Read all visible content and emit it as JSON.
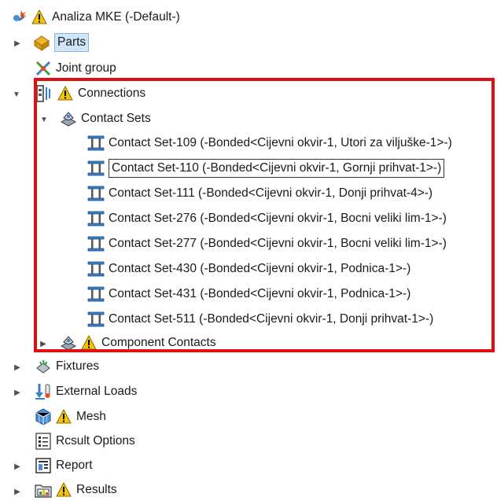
{
  "tree": {
    "root": {
      "label": "Analiza MKE (-Default-)",
      "icon": "study-icon"
    },
    "parts": {
      "label": "Parts",
      "icon": "parts-icon"
    },
    "joint_group": {
      "label": "Joint group",
      "icon": "joint-group-icon"
    },
    "connections": {
      "label": "Connections",
      "icon": "connections-icon"
    },
    "contact_sets": {
      "label": "Contact Sets",
      "icon": "contact-sets-icon"
    },
    "contact_set_items": [
      {
        "label": "Contact Set-109 (-Bonded<Cijevni okvir-1, Utori za viljuške-1>-)"
      },
      {
        "label": "Contact Set-110 (-Bonded<Cijevni okvir-1, Gornji prihvat-1>-)"
      },
      {
        "label": "Contact Set-111 (-Bonded<Cijevni okvir-1, Donji prihvat-4>-)"
      },
      {
        "label": "Contact Set-276 (-Bonded<Cijevni okvir-1, Bocni veliki lim-1>-)"
      },
      {
        "label": "Contact Set-277 (-Bonded<Cijevni okvir-1, Bocni veliki lim-1>-)"
      },
      {
        "label": "Contact Set-430 (-Bonded<Cijevni okvir-1, Podnica-1>-)"
      },
      {
        "label": "Contact Set-431 (-Bonded<Cijevni okvir-1, Podnica-1>-)"
      },
      {
        "label": "Contact Set-511 (-Bonded<Cijevni okvir-1, Donji prihvat-1>-)"
      }
    ],
    "component_contacts": {
      "label": "Component Contacts",
      "icon": "component-contacts-icon"
    },
    "fixtures": {
      "label": "Fixtures",
      "icon": "fixtures-icon"
    },
    "external_loads": {
      "label": "External Loads",
      "icon": "external-loads-icon"
    },
    "mesh": {
      "label": "Mesh",
      "icon": "mesh-icon"
    },
    "result_options": {
      "label": "Rcsult Options",
      "icon": "result-options-icon"
    },
    "report": {
      "label": "Report",
      "icon": "report-icon"
    },
    "results": {
      "label": "Results",
      "icon": "results-icon"
    }
  },
  "colors": {
    "highlight_box": "#e01010",
    "selection_fill": "#cfe5f8",
    "warning": "#f4c20d"
  }
}
